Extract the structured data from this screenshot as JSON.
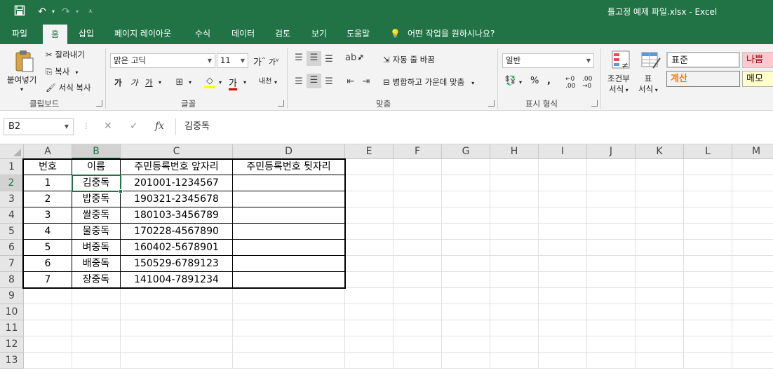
{
  "window": {
    "title": "틀고정 예제 파일.xlsx  -  Excel",
    "undo_icon": "undo-icon",
    "redo_icon": "redo-icon",
    "save_icon": "save-icon"
  },
  "tabs": [
    "파일",
    "홈",
    "삽입",
    "페이지 레이아웃",
    "수식",
    "데이터",
    "검토",
    "보기",
    "도움말"
  ],
  "tell_me": "어떤 작업을 원하시나요?",
  "ribbon": {
    "clipboard": {
      "paste": "붙여넣기",
      "cut": "잘라내기",
      "copy": "복사",
      "format_painter": "서식 복사",
      "label": "클립보드"
    },
    "font": {
      "name": "맑은 고딕",
      "size": "11",
      "grow": "가",
      "shrink": "가",
      "bold": "가",
      "italic": "가",
      "underline": "가",
      "font_color": "가",
      "phonetic": "내천",
      "label": "글꼴"
    },
    "alignment": {
      "wrap": "자동 줄 바꿈",
      "merge": "병합하고 가운데 맞춤",
      "label": "맞춤"
    },
    "number": {
      "format": "일반",
      "label": "표시 형식"
    },
    "styles": {
      "conditional": [
        "조건부",
        "서식"
      ],
      "table": [
        "표",
        "서식"
      ],
      "normal": "표준",
      "bad": "나쁨",
      "calc": "계산",
      "memo": "메모",
      "colors": {
        "bad_bg": "#ffc7ce",
        "bad_fg": "#9c0006",
        "calc_fg": "#fa7d00"
      }
    }
  },
  "formula_bar": {
    "name_box": "B2",
    "cancel": "✕",
    "enter": "✓",
    "fx": "fx",
    "content": "김중독"
  },
  "sheet": {
    "columns": [
      "A",
      "B",
      "C",
      "D",
      "E",
      "F",
      "G",
      "H",
      "I",
      "J",
      "K",
      "L",
      "M"
    ],
    "rows": [
      "1",
      "2",
      "3",
      "4",
      "5",
      "6",
      "7",
      "8",
      "9",
      "10",
      "11",
      "12",
      "13"
    ],
    "selected_col": "B",
    "selected_row": "2",
    "header": [
      "번호",
      "이름",
      "주민등록번호 앞자리",
      "주민등록번호 뒷자리"
    ],
    "data": [
      [
        "1",
        "김중독",
        "201001-1234567",
        ""
      ],
      [
        "2",
        "밥중독",
        "190321-2345678",
        ""
      ],
      [
        "3",
        "쌀중독",
        "180103-3456789",
        ""
      ],
      [
        "4",
        "물중독",
        "170228-4567890",
        ""
      ],
      [
        "5",
        "벼중독",
        "160402-5678901",
        ""
      ],
      [
        "6",
        "배중독",
        "150529-6789123",
        ""
      ],
      [
        "7",
        "장중독",
        "141004-7891234",
        ""
      ]
    ]
  },
  "accent_color": "#217346"
}
